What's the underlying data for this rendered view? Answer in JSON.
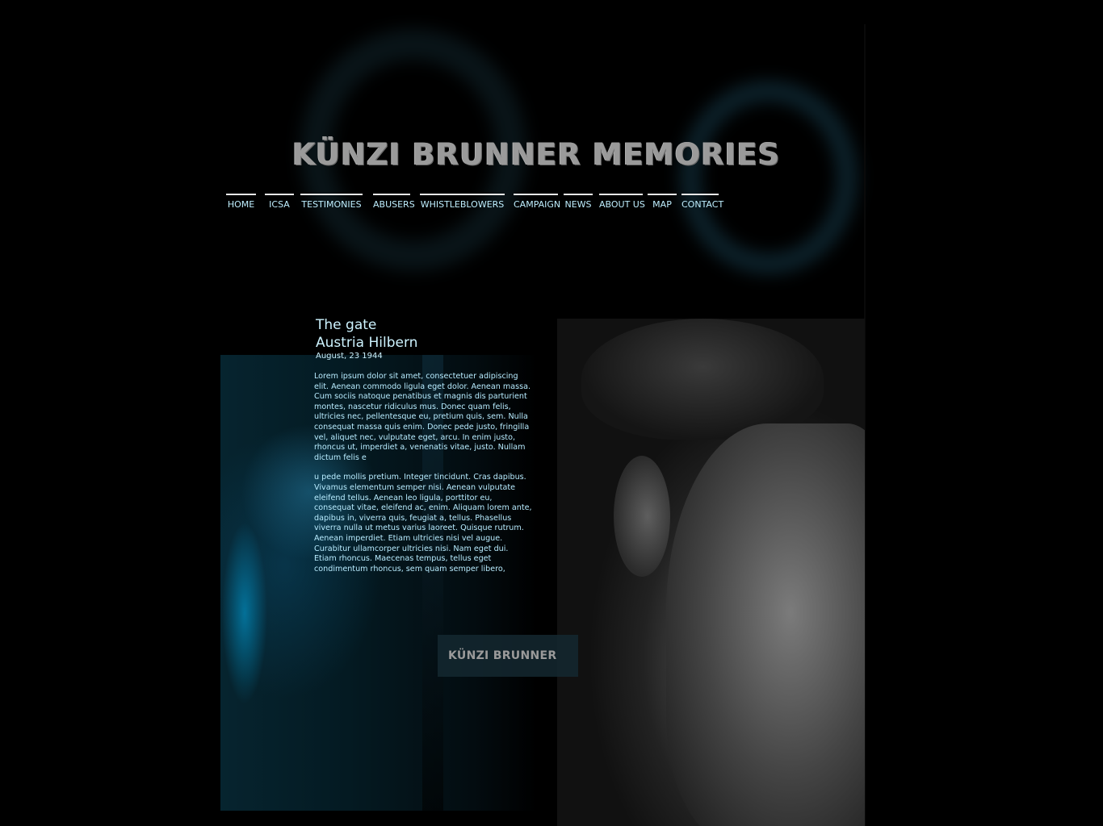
{
  "site": {
    "title": "KÜNZI BRUNNER MEMORIES"
  },
  "nav": {
    "items": [
      {
        "label": "HOME"
      },
      {
        "label": "ICSA"
      },
      {
        "label": "TESTIMONIES"
      },
      {
        "label": "ABUSERS"
      },
      {
        "label": "WHISTLEBLOWERS"
      },
      {
        "label": "CAMPAIGN"
      },
      {
        "label": "NEWS"
      },
      {
        "label": "ABOUT US"
      },
      {
        "label": "MAP"
      },
      {
        "label": "CONTACT"
      }
    ]
  },
  "article": {
    "title_line1": "The gate",
    "title_line2": "Austria  Hilbern",
    "date": "August, 23 1944",
    "paragraph1": "Lorem ipsum dolor sit amet, consectetuer adipiscing elit. Aenean commodo ligula eget dolor. Aenean massa. Cum sociis natoque penatibus et magnis dis parturient montes, nascetur ridiculus mus. Donec quam felis, ultricies nec, pellentesque eu, pretium quis, sem. Nulla consequat massa quis enim. Donec pede justo, fringilla vel, aliquet nec, vulputate eget, arcu. In enim justo, rhoncus ut, imperdiet a, venenatis vitae, justo. Nullam dictum felis e",
    "paragraph2": "u pede mollis pretium. Integer tincidunt. Cras dapibus. Vivamus elementum semper nisi. Aenean vulputate eleifend tellus. Aenean leo ligula, porttitor eu, consequat vitae, eleifend ac, enim. Aliquam lorem ante, dapibus in, viverra quis, feugiat a, tellus. Phasellus viverra nulla ut metus varius laoreet. Quisque rutrum. Aenean imperdiet. Etiam ultricies nisi vel augue. Curabitur ullamcorper ultricies nisi. Nam eget dui. Etiam rhoncus. Maecenas tempus, tellus eget condimentum rhoncus, sem quam semper libero,"
  },
  "signature": {
    "text": "KÜNZI BRUNNER"
  },
  "colors": {
    "background": "#000000",
    "nav_text": "#bfefff",
    "article_text": "#b8ecff",
    "title_gray": "#9a9a9a"
  }
}
